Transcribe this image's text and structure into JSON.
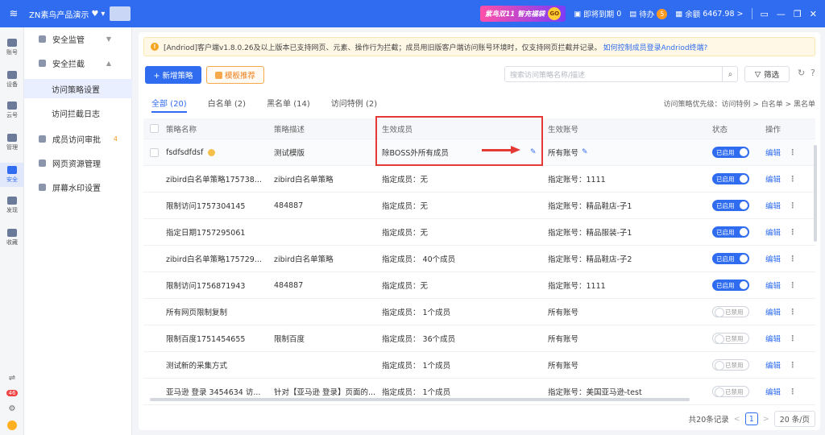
{
  "topbar": {
    "title": "ZN素鸟产品演示",
    "promo_text": "紫鸟双11  智充福袋",
    "promo_go": "GO",
    "expiring_label": "即将到期",
    "expiring_count": "0",
    "todo_label": "待办",
    "todo_count": "5",
    "balance_label": "余额",
    "balance_value": "6467.98",
    "balance_arrow": ">"
  },
  "rail": {
    "items": [
      {
        "label": "账号",
        "icon": "account-icon"
      },
      {
        "label": "设备",
        "icon": "device-icon"
      },
      {
        "label": "云号",
        "icon": "cloud-icon"
      },
      {
        "label": "管理",
        "icon": "manage-icon"
      },
      {
        "label": "安全",
        "icon": "security-icon"
      },
      {
        "label": "发现",
        "icon": "discover-icon"
      },
      {
        "label": "收藏",
        "icon": "star-icon"
      }
    ],
    "badge": "46"
  },
  "sidebar": {
    "security_monitor": "安全监管",
    "security_block": "安全拦截",
    "access_policy": "访问策略设置",
    "block_log": "访问拦截日志",
    "member_review": "成员访问审批",
    "member_review_count": "4",
    "web_resource": "网页资源管理",
    "watermark": "屏幕水印设置"
  },
  "notice": {
    "text": "[Andriod]客户端v1.8.0.26及以上版本已支持网页、元素、操作行为拦截；成员用旧版客户端访问账号环境时，仅支持网页拦截并记录。",
    "link": "如何控制成员登录Andriod终端?"
  },
  "toolbar": {
    "new_label": "+ 新增策略",
    "template_label": "模板推荐",
    "search_placeholder": "搜索访问策略名称/描述",
    "filter_label": "筛选"
  },
  "tabs": [
    {
      "label": "全部  (20)"
    },
    {
      "label": "白名单  (2)"
    },
    {
      "label": "黑名单  (14)"
    },
    {
      "label": "访问特例  (2)"
    }
  ],
  "priority_text": "访问策略优先级：访问特例 > 白名单 > 黑名单",
  "table": {
    "headers": {
      "name": "策略名称",
      "desc": "策略描述",
      "members": "生效成员",
      "accounts": "生效账号",
      "status": "状态",
      "action": "操作"
    },
    "rows": [
      {
        "name": "fsdfsdfdsf",
        "desc": "测试模版",
        "members": "除BOSS外所有成员",
        "accounts": "所有账号",
        "status": "已启用",
        "on": true
      },
      {
        "name": "zibird白名单策略175738...",
        "desc": "zibird白名单策略",
        "members": "指定成员：无",
        "accounts": "指定账号：1111",
        "status": "已启用",
        "on": true
      },
      {
        "name": "限制访问1757304145",
        "desc": "484887",
        "members": "指定成员：无",
        "accounts": "指定账号：精品鞋店-子1",
        "status": "已启用",
        "on": true
      },
      {
        "name": "指定日期1757295061",
        "desc": "",
        "members": "指定成员：无",
        "accounts": "指定账号：精品服装-子1",
        "status": "已启用",
        "on": true
      },
      {
        "name": "zibird白名单策略175729...",
        "desc": "zibird白名单策略",
        "members": "指定成员：  40个成员",
        "accounts": "指定账号：精品鞋店-子2",
        "status": "已启用",
        "on": true
      },
      {
        "name": "限制访问1756871943",
        "desc": "484887",
        "members": "指定成员：无",
        "accounts": "指定账号：1111",
        "status": "已启用",
        "on": true
      },
      {
        "name": "所有网页限制复制",
        "desc": "",
        "members": "指定成员：  1个成员",
        "accounts": "所有账号",
        "status": "已禁用",
        "on": false
      },
      {
        "name": "限制百度1751454655",
        "desc": "限制百度",
        "members": "指定成员：  36个成员",
        "accounts": "所有账号",
        "status": "已禁用",
        "on": false
      },
      {
        "name": "测试新的采集方式",
        "desc": "",
        "members": "指定成员：  1个成员",
        "accounts": "所有账号",
        "status": "已禁用",
        "on": false
      },
      {
        "name": "亚马逊 登录 3454634 访...",
        "desc": "针对【亚马逊 登录】页面的...",
        "members": "指定成员：  1个成员",
        "accounts": "指定账号：美国亚马逊-test",
        "status": "已禁用",
        "on": false
      }
    ],
    "edit_label": "编辑",
    "more_label": "⋮"
  },
  "pager": {
    "total": "共20条记录",
    "prev": "<",
    "current": "1",
    "next": ">",
    "size": "20 条/页"
  }
}
